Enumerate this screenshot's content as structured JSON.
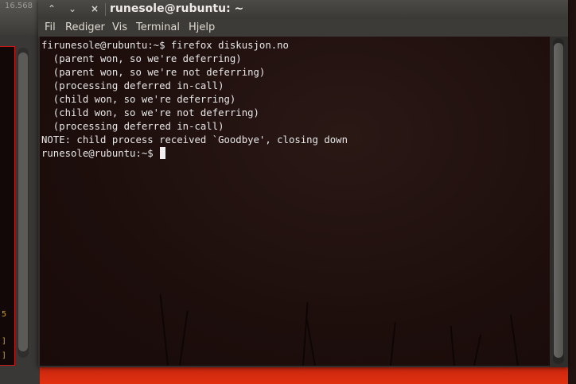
{
  "background": {
    "partial_text": "16.568",
    "marks": [
      "5",
      "]",
      "]"
    ]
  },
  "window": {
    "title": "runesole@rubuntu: ~",
    "buttons": {
      "minimize": "⌃",
      "maximize": "⌄",
      "close": "×"
    }
  },
  "menubar": {
    "items": [
      "Fil",
      "Rediger",
      "Vis",
      "Terminal",
      "Hjelp"
    ]
  },
  "terminal": {
    "lines": [
      "firunesole@rubuntu:~$ firefox diskusjon.no",
      "  (parent won, so we're deferring)",
      "  (parent won, so we're not deferring)",
      "  (processing deferred in-call)",
      "  (child won, so we're deferring)",
      "  (child won, so we're not deferring)",
      "  (processing deferred in-call)",
      "NOTE: child process received `Goodbye', closing down"
    ],
    "prompt": "runesole@rubuntu:~$ "
  },
  "colors": {
    "terminal_text": "#e8e8e8",
    "titlebar": "#3a3936",
    "wallpaper_glow": "#e0300f"
  }
}
